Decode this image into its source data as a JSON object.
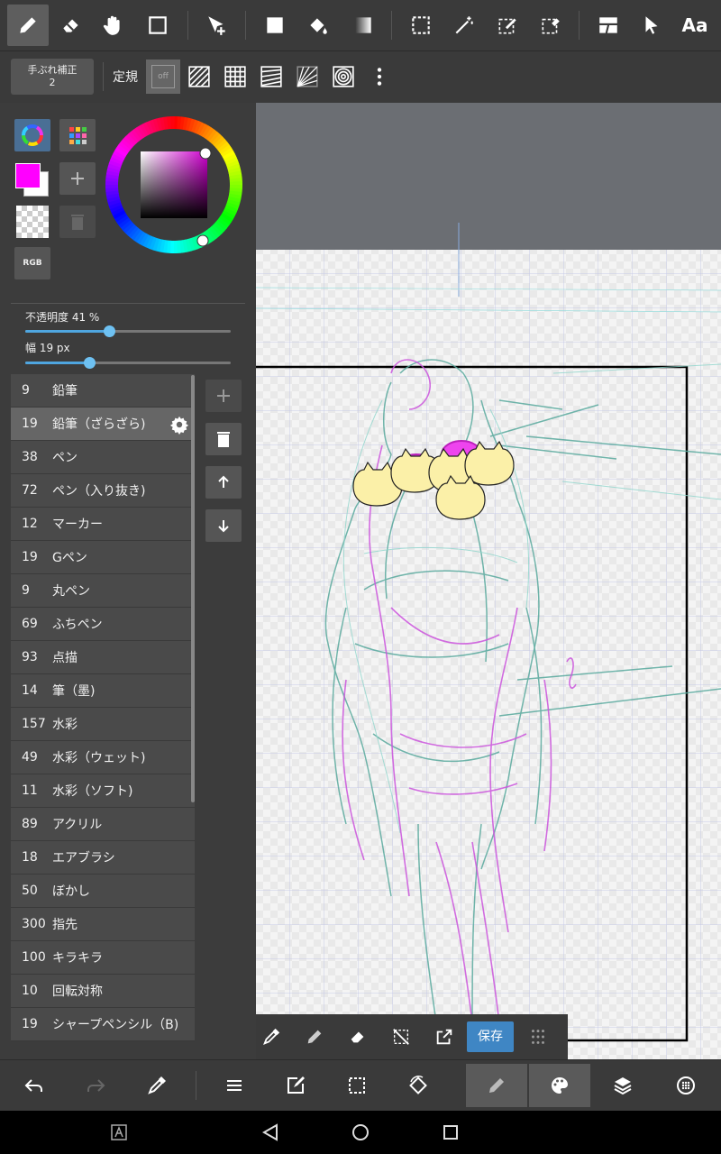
{
  "toolbar": {
    "tools": [
      "pen-tool-icon",
      "eraser-tool-icon",
      "hand-tool-icon",
      "rectangle-tool-icon",
      "move-tool-icon",
      "fill-rect-tool-icon",
      "bucket-tool-icon",
      "gradient-tool-icon",
      "select-rect-tool-icon",
      "magic-wand-tool-icon",
      "select-pen-tool-icon",
      "select-eraser-tool-icon",
      "panel-tool-icon",
      "pointer-tool-icon",
      "text-tool-icon"
    ],
    "text_tool_label": "Aa"
  },
  "subbar": {
    "stabilizer_label": "手ぶれ補正",
    "stabilizer_value": "2",
    "ruler_label": "定規",
    "ruler_off_label": "off"
  },
  "color": {
    "current": "#ff00ff",
    "mode_label": "RGB"
  },
  "sliders": {
    "opacity_label": "不透明度 41 %",
    "opacity_value": 41,
    "width_label": "幅 19 px",
    "width_value": 19
  },
  "brushes": [
    {
      "size": "9",
      "name": "鉛筆"
    },
    {
      "size": "19",
      "name": "鉛筆（ざらざら)"
    },
    {
      "size": "38",
      "name": "ペン"
    },
    {
      "size": "72",
      "name": "ペン（入り抜き)"
    },
    {
      "size": "12",
      "name": "マーカー"
    },
    {
      "size": "19",
      "name": "Gペン"
    },
    {
      "size": "9",
      "name": "丸ペン"
    },
    {
      "size": "69",
      "name": "ふちペン"
    },
    {
      "size": "93",
      "name": "点描"
    },
    {
      "size": "14",
      "name": "筆（墨)"
    },
    {
      "size": "157",
      "name": "水彩"
    },
    {
      "size": "49",
      "name": "水彩（ウェット)"
    },
    {
      "size": "11",
      "name": "水彩（ソフト)"
    },
    {
      "size": "89",
      "name": "アクリル"
    },
    {
      "size": "18",
      "name": "エアブラシ"
    },
    {
      "size": "50",
      "name": "ぼかし"
    },
    {
      "size": "300",
      "name": "指先"
    },
    {
      "size": "100",
      "name": "キラキラ"
    },
    {
      "size": "10",
      "name": "回転対称"
    },
    {
      "size": "19",
      "name": "シャープペンシル（B)"
    }
  ],
  "selected_brush_index": 1,
  "floatbar": {
    "save_label": "保存"
  }
}
